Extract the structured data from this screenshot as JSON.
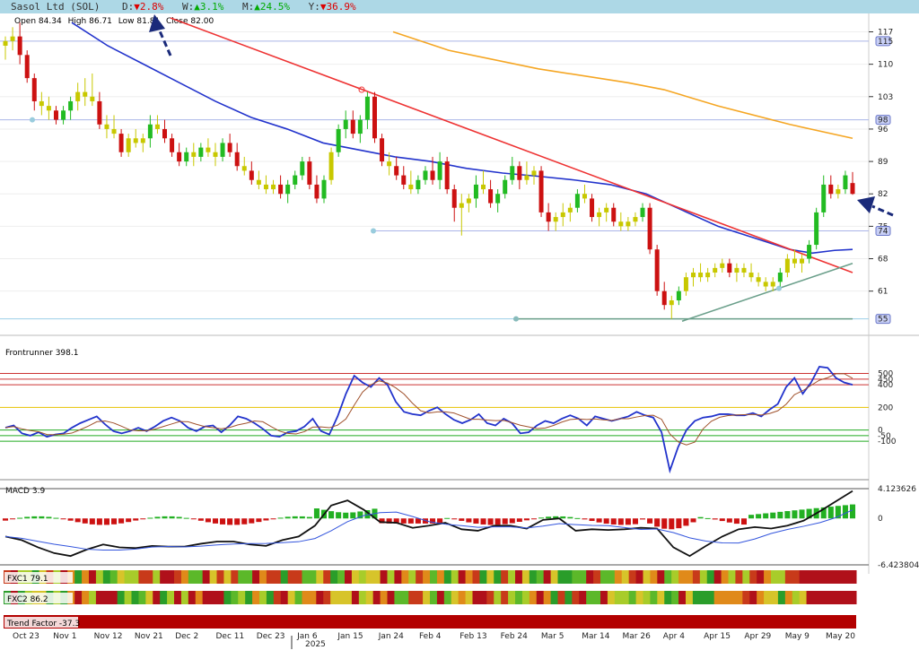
{
  "header": {
    "title": "Sasol Ltd (SOL)",
    "d_label": "D:",
    "d_value": "▼2.8%",
    "w_label": "W:",
    "w_value": "▲3.1%",
    "m_label": "M:",
    "m_value": "▲24.5%",
    "y_label": "Y:",
    "y_value": "▼36.9%"
  },
  "ohlc_text": {
    "open_label": "Open",
    "open": "84.34",
    "high_label": "High",
    "high": "86.71",
    "low_label": "Low",
    "low": "81.81",
    "close_label": "Close",
    "close": "82.00"
  },
  "colors": {
    "up": "#22bb22",
    "down": "#cc1111",
    "neutral": "#c8c800",
    "trend_red": "#e33",
    "ma_blue": "#2233cc",
    "ma_orange": "#f5a623",
    "support_green": "#6a9f8a",
    "level_line": "#aab4e8"
  },
  "chart_data": {
    "type": "candlestick",
    "x_ticks": [
      "Oct 23",
      "Nov 1",
      "Nov 12",
      "Nov 21",
      "Dec 2",
      "Dec 11",
      "Dec 23",
      "Jan 6",
      "Jan 15",
      "Jan 24",
      "Feb 4",
      "Feb 13",
      "Feb 24",
      "Mar 5",
      "Mar 14",
      "Mar 26",
      "Apr 4",
      "Apr 15",
      "Apr 29",
      "May 9",
      "May 20"
    ],
    "year_label": "2025",
    "y_ticks": [
      117,
      110,
      103,
      96,
      89,
      82,
      75,
      68,
      61
    ],
    "price_tags": [
      115,
      98,
      74,
      55
    ],
    "ylim": [
      53,
      120
    ],
    "candles": [
      [
        114,
        116,
        111,
        115
      ],
      [
        115,
        118,
        113,
        116
      ],
      [
        116,
        119,
        110,
        112
      ],
      [
        112,
        113,
        106,
        107
      ],
      [
        107,
        108,
        100,
        102
      ],
      [
        102,
        104,
        99,
        101
      ],
      [
        101,
        103,
        98,
        100
      ],
      [
        100,
        101,
        97,
        98
      ],
      [
        98,
        101,
        97,
        100
      ],
      [
        100,
        103,
        98,
        102
      ],
      [
        102,
        106,
        100,
        104
      ],
      [
        104,
        107,
        101,
        103
      ],
      [
        103,
        108,
        101,
        102
      ],
      [
        102,
        104,
        96,
        97
      ],
      [
        97,
        99,
        94,
        96
      ],
      [
        96,
        99,
        94,
        95
      ],
      [
        95,
        96,
        90,
        91
      ],
      [
        91,
        95,
        90,
        94
      ],
      [
        94,
        96,
        92,
        93
      ],
      [
        93,
        95,
        91,
        94
      ],
      [
        94,
        99,
        92,
        97
      ],
      [
        97,
        99,
        95,
        96
      ],
      [
        96,
        98,
        93,
        94
      ],
      [
        94,
        95,
        90,
        91
      ],
      [
        91,
        93,
        88,
        89
      ],
      [
        89,
        92,
        88,
        91
      ],
      [
        91,
        93,
        88,
        90
      ],
      [
        90,
        93,
        89,
        92
      ],
      [
        92,
        94,
        90,
        91
      ],
      [
        91,
        93,
        88,
        90
      ],
      [
        90,
        94,
        89,
        93
      ],
      [
        93,
        95,
        90,
        91
      ],
      [
        91,
        93,
        87,
        88
      ],
      [
        88,
        90,
        86,
        87
      ],
      [
        87,
        89,
        84,
        85
      ],
      [
        85,
        87,
        83,
        84
      ],
      [
        84,
        86,
        82,
        83
      ],
      [
        83,
        85,
        82,
        84
      ],
      [
        84,
        86,
        81,
        82
      ],
      [
        82,
        85,
        80,
        84
      ],
      [
        84,
        87,
        83,
        86
      ],
      [
        86,
        90,
        85,
        89
      ],
      [
        89,
        90,
        83,
        84
      ],
      [
        84,
        86,
        80,
        81
      ],
      [
        81,
        86,
        80,
        85
      ],
      [
        85,
        92,
        84,
        91
      ],
      [
        91,
        97,
        90,
        96
      ],
      [
        96,
        100,
        94,
        98
      ],
      [
        98,
        100,
        94,
        95
      ],
      [
        95,
        99,
        93,
        98
      ],
      [
        98,
        104,
        96,
        103
      ],
      [
        103,
        104,
        93,
        94
      ],
      [
        94,
        95,
        88,
        89
      ],
      [
        89,
        91,
        86,
        88
      ],
      [
        88,
        90,
        85,
        86
      ],
      [
        86,
        88,
        83,
        84
      ],
      [
        84,
        87,
        82,
        83
      ],
      [
        83,
        86,
        82,
        85
      ],
      [
        85,
        88,
        84,
        87
      ],
      [
        87,
        90,
        84,
        85
      ],
      [
        85,
        91,
        83,
        89
      ],
      [
        89,
        90,
        82,
        83
      ],
      [
        83,
        84,
        76,
        79
      ],
      [
        79,
        82,
        73,
        80
      ],
      [
        80,
        82,
        78,
        81
      ],
      [
        81,
        86,
        79,
        84
      ],
      [
        84,
        87,
        82,
        83
      ],
      [
        83,
        85,
        79,
        80
      ],
      [
        80,
        83,
        78,
        82
      ],
      [
        82,
        86,
        81,
        85
      ],
      [
        85,
        90,
        84,
        88
      ],
      [
        88,
        89,
        83,
        85
      ],
      [
        85,
        89,
        84,
        86
      ],
      [
        86,
        88,
        84,
        87
      ],
      [
        87,
        88,
        77,
        78
      ],
      [
        78,
        80,
        74,
        76
      ],
      [
        76,
        78,
        74,
        77
      ],
      [
        77,
        80,
        75,
        78
      ],
      [
        78,
        80,
        76,
        79
      ],
      [
        79,
        83,
        78,
        82
      ],
      [
        82,
        84,
        80,
        81
      ],
      [
        81,
        82,
        76,
        77
      ],
      [
        77,
        79,
        75,
        78
      ],
      [
        78,
        80,
        76,
        79
      ],
      [
        79,
        80,
        75,
        76
      ],
      [
        76,
        78,
        74,
        75
      ],
      [
        75,
        77,
        74,
        76
      ],
      [
        76,
        78,
        75,
        77
      ],
      [
        77,
        80,
        76,
        79
      ],
      [
        79,
        80,
        69,
        70
      ],
      [
        70,
        71,
        60,
        61
      ],
      [
        61,
        63,
        57,
        58
      ],
      [
        58,
        60,
        55,
        59
      ],
      [
        59,
        62,
        58,
        61
      ],
      [
        61,
        65,
        60,
        64
      ],
      [
        64,
        66,
        62,
        65
      ],
      [
        65,
        67,
        63,
        64
      ],
      [
        64,
        66,
        63,
        65
      ],
      [
        65,
        67,
        64,
        66
      ],
      [
        66,
        68,
        65,
        67
      ],
      [
        67,
        68,
        64,
        65
      ],
      [
        65,
        67,
        63,
        66
      ],
      [
        66,
        67,
        64,
        65
      ],
      [
        65,
        67,
        63,
        64
      ],
      [
        64,
        65,
        62,
        63
      ],
      [
        63,
        64,
        61,
        62
      ],
      [
        62,
        64,
        61,
        63
      ],
      [
        63,
        66,
        62,
        65
      ],
      [
        65,
        69,
        64,
        68
      ],
      [
        68,
        70,
        66,
        67
      ],
      [
        67,
        69,
        65,
        68
      ],
      [
        68,
        72,
        67,
        71
      ],
      [
        71,
        79,
        70,
        78
      ],
      [
        78,
        86,
        77,
        84
      ],
      [
        84,
        86,
        81,
        82
      ],
      [
        82,
        84,
        81,
        83
      ],
      [
        83,
        87,
        82,
        86
      ],
      [
        84.34,
        86.71,
        81.81,
        82.0
      ]
    ],
    "frontrunner": {
      "label": "Frontrunner",
      "value": "398.1",
      "ticks": [
        500,
        450,
        400,
        200,
        0,
        -50,
        -100
      ]
    },
    "macd": {
      "label": "MACD",
      "value": "3.9",
      "ticks": [
        "4.123626",
        "0",
        "-6.423804"
      ]
    },
    "fxc1": {
      "label": "FXC1",
      "value": "79.1"
    },
    "fxc2": {
      "label": "FXC2",
      "value": "86.2"
    },
    "trend_factor": {
      "label": "Trend Factor",
      "value": "-37.3"
    }
  }
}
